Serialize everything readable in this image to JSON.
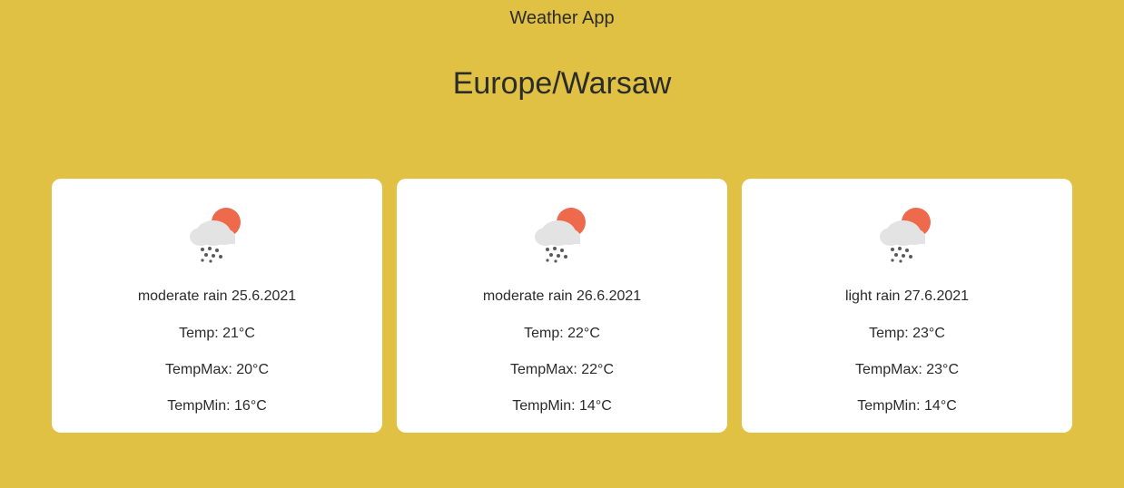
{
  "app": {
    "title": "Weather App",
    "location": "Europe/Warsaw"
  },
  "colors": {
    "background": "#e0c144",
    "card": "#ffffff",
    "sun": "#ee6a4c",
    "cloud": "#e3e3e3",
    "rain": "#5a5a5a"
  },
  "forecast": [
    {
      "icon": "cloud-sun-rain-icon",
      "description": "moderate rain 25.6.2021",
      "temp": "Temp: 21°C",
      "temp_max": "TempMax: 20°C",
      "temp_min": "TempMin: 16°C"
    },
    {
      "icon": "cloud-sun-rain-icon",
      "description": "moderate rain 26.6.2021",
      "temp": "Temp: 22°C",
      "temp_max": "TempMax: 22°C",
      "temp_min": "TempMin: 14°C"
    },
    {
      "icon": "cloud-sun-rain-icon",
      "description": "light rain 27.6.2021",
      "temp": "Temp: 23°C",
      "temp_max": "TempMax: 23°C",
      "temp_min": "TempMin: 14°C"
    }
  ]
}
